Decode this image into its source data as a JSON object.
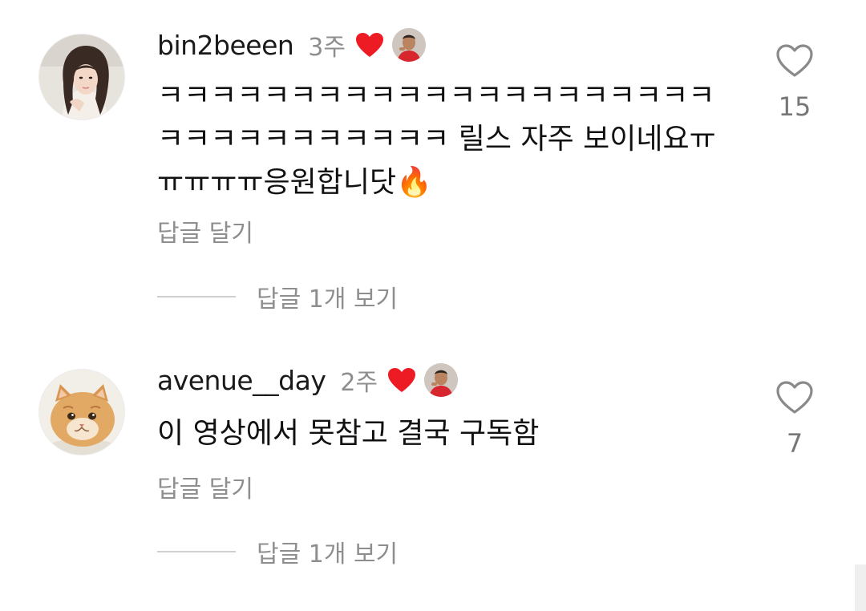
{
  "comments": [
    {
      "username": "bin2beeen",
      "time": "3주",
      "text": "ㅋㅋㅋㅋㅋㅋㅋㅋㅋㅋㅋㅋㅋㅋㅋㅋㅋㅋㅋㅋㅋㅋㅋㅋㅋㅋㅋㅋㅋㅋㅋㅋ 릴스 자주 보이네요ㅠㅠㅠㅠㅠ응원합니닷🔥",
      "reply_label": "답글 달기",
      "view_replies_label": "답글 1개 보기",
      "like_count": "15",
      "liked_by_author": true
    },
    {
      "username": "avenue__day",
      "time": "2주",
      "text": "이 영상에서 못참고 결국 구독함",
      "reply_label": "답글 달기",
      "view_replies_label": "답글 1개 보기",
      "like_count": "7",
      "liked_by_author": true
    }
  ],
  "icons": {
    "author_heart": "filled-heart-icon",
    "like": "heart-outline-icon"
  },
  "colors": {
    "author_heart": "#ed1c24",
    "secondary_text": "#8e8e8e"
  }
}
